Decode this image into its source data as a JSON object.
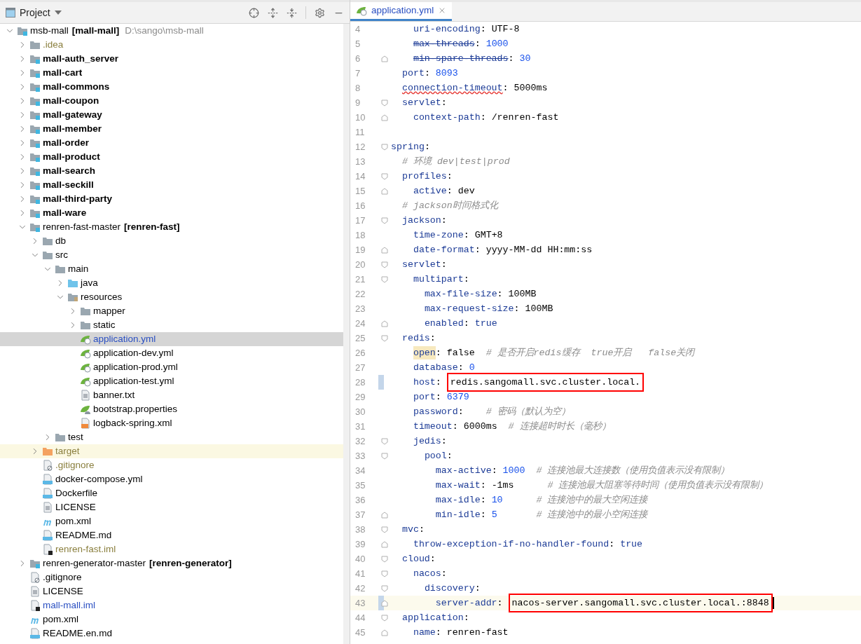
{
  "project_panel": {
    "title": "Project",
    "tree": [
      {
        "name": "msb-mall",
        "tag": "[mall-mall]",
        "path": "D:\\sango\\msb-mall",
        "kind": "module",
        "bold": false,
        "color": "#000000",
        "selected": false,
        "expanded": true,
        "children": [
          {
            "name": ".idea",
            "kind": "folder",
            "bold": false,
            "color": "#8a7f3e",
            "selected": false,
            "expanded": false
          },
          {
            "name": "mall-auth_server",
            "kind": "module",
            "bold": true,
            "color": "#000000",
            "selected": false,
            "expanded": false
          },
          {
            "name": "mall-cart",
            "kind": "module",
            "bold": true,
            "color": "#000000",
            "selected": false,
            "expanded": false
          },
          {
            "name": "mall-commons",
            "kind": "module",
            "bold": true,
            "color": "#000000",
            "selected": false,
            "expanded": false
          },
          {
            "name": "mall-coupon",
            "kind": "module",
            "bold": true,
            "color": "#000000",
            "selected": false,
            "expanded": false
          },
          {
            "name": "mall-gateway",
            "kind": "module",
            "bold": true,
            "color": "#000000",
            "selected": false,
            "expanded": false
          },
          {
            "name": "mall-member",
            "kind": "module",
            "bold": true,
            "color": "#000000",
            "selected": false,
            "expanded": false
          },
          {
            "name": "mall-order",
            "kind": "module",
            "bold": true,
            "color": "#000000",
            "selected": false,
            "expanded": false
          },
          {
            "name": "mall-product",
            "kind": "module",
            "bold": true,
            "color": "#000000",
            "selected": false,
            "expanded": false
          },
          {
            "name": "mall-search",
            "kind": "module",
            "bold": true,
            "color": "#000000",
            "selected": false,
            "expanded": false
          },
          {
            "name": "mall-seckill",
            "kind": "module",
            "bold": true,
            "color": "#000000",
            "selected": false,
            "expanded": false
          },
          {
            "name": "mall-third-party",
            "kind": "module",
            "bold": true,
            "color": "#000000",
            "selected": false,
            "expanded": false
          },
          {
            "name": "mall-ware",
            "kind": "module",
            "bold": true,
            "color": "#000000",
            "selected": false,
            "expanded": false
          },
          {
            "name": "renren-fast-master",
            "tag": "[renren-fast]",
            "kind": "module",
            "bold": false,
            "color": "#000000",
            "selected": false,
            "expanded": true,
            "children": [
              {
                "name": "db",
                "kind": "folder",
                "bold": false,
                "color": "#000000",
                "selected": false,
                "expanded": false
              },
              {
                "name": "src",
                "kind": "folder",
                "bold": false,
                "color": "#000000",
                "selected": false,
                "expanded": true,
                "children": [
                  {
                    "name": "main",
                    "kind": "folder",
                    "bold": false,
                    "color": "#000000",
                    "selected": false,
                    "expanded": true,
                    "children": [
                      {
                        "name": "java",
                        "kind": "source",
                        "bold": false,
                        "color": "#000000",
                        "selected": false,
                        "expanded": false
                      },
                      {
                        "name": "resources",
                        "kind": "resources",
                        "bold": false,
                        "color": "#000000",
                        "selected": false,
                        "expanded": true,
                        "children": [
                          {
                            "name": "mapper",
                            "kind": "folder",
                            "bold": false,
                            "color": "#000000",
                            "selected": false,
                            "expanded": false
                          },
                          {
                            "name": "static",
                            "kind": "folder",
                            "bold": false,
                            "color": "#000000",
                            "selected": false,
                            "expanded": false
                          },
                          {
                            "name": "application.yml",
                            "kind": "spring",
                            "bold": false,
                            "color": "#2a4fc2",
                            "selected": true
                          },
                          {
                            "name": "application-dev.yml",
                            "kind": "spring",
                            "bold": false,
                            "color": "#000000",
                            "selected": false
                          },
                          {
                            "name": "application-prod.yml",
                            "kind": "spring",
                            "bold": false,
                            "color": "#000000",
                            "selected": false
                          },
                          {
                            "name": "application-test.yml",
                            "kind": "spring",
                            "bold": false,
                            "color": "#000000",
                            "selected": false
                          },
                          {
                            "name": "banner.txt",
                            "kind": "text",
                            "bold": false,
                            "color": "#000000",
                            "selected": false
                          },
                          {
                            "name": "bootstrap.properties",
                            "kind": "properties",
                            "bold": false,
                            "color": "#000000",
                            "selected": false
                          },
                          {
                            "name": "logback-spring.xml",
                            "kind": "xml",
                            "bold": false,
                            "color": "#000000",
                            "selected": false
                          }
                        ]
                      }
                    ]
                  },
                  {
                    "name": "test",
                    "kind": "folder",
                    "bold": false,
                    "color": "#000000",
                    "selected": false,
                    "expanded": false
                  }
                ]
              },
              {
                "name": "target",
                "kind": "excluded",
                "bold": false,
                "color": "#8a7f3e",
                "selected": false,
                "expanded": false
              },
              {
                "name": ".gitignore",
                "kind": "ignore",
                "bold": false,
                "color": "#8a7f3e",
                "selected": false
              },
              {
                "name": "docker-compose.yml",
                "kind": "compose",
                "bold": false,
                "color": "#000000",
                "selected": false
              },
              {
                "name": "Dockerfile",
                "kind": "docker",
                "bold": false,
                "color": "#000000",
                "selected": false
              },
              {
                "name": "LICENSE",
                "kind": "text",
                "bold": false,
                "color": "#000000",
                "selected": false
              },
              {
                "name": "pom.xml",
                "kind": "maven",
                "bold": false,
                "color": "#000000",
                "selected": false
              },
              {
                "name": "README.md",
                "kind": "markdown",
                "bold": false,
                "color": "#000000",
                "selected": false
              },
              {
                "name": "renren-fast.iml",
                "kind": "iml",
                "bold": false,
                "color": "#8a7f3e",
                "selected": false
              }
            ]
          },
          {
            "name": "renren-generator-master",
            "tag": "[renren-generator]",
            "kind": "module",
            "bold": false,
            "color": "#000000",
            "selected": false,
            "expanded": false
          },
          {
            "name": ".gitignore",
            "kind": "ignore",
            "bold": false,
            "color": "#000000",
            "selected": false
          },
          {
            "name": "LICENSE",
            "kind": "text",
            "bold": false,
            "color": "#000000",
            "selected": false
          },
          {
            "name": "mall-mall.iml",
            "kind": "iml",
            "bold": false,
            "color": "#2a4fc2",
            "selected": false
          },
          {
            "name": "pom.xml",
            "kind": "maven",
            "bold": false,
            "color": "#000000",
            "selected": false
          },
          {
            "name": "README.en.md",
            "kind": "markdown",
            "bold": false,
            "color": "#000000",
            "selected": false
          }
        ]
      }
    ]
  },
  "editor": {
    "tabs": [
      {
        "label": "application.yml",
        "selected": true
      }
    ],
    "lines": [
      {
        "children": [
          {
            "children": [
              {
                "n": "4",
                "segs": [
                  {
                    "kind": "key",
                    "text": "uri-encoding"
                  },
                  {
                    "kind": "punct",
                    "text": ": "
                  },
                  {
                    "kind": "string",
                    "text": "UTF-8"
                  }
                ]
              },
              {
                "n": "5",
                "segs": [
                  {
                    "kind": "key",
                    "text": "max-threads",
                    "deprecated": true
                  },
                  {
                    "kind": "punct",
                    "text": ": "
                  },
                  {
                    "kind": "number",
                    "text": "1000"
                  }
                ]
              },
              {
                "n": "6",
                "segs": [
                  {
                    "kind": "key",
                    "text": "min-spare-threads",
                    "deprecated": true
                  },
                  {
                    "kind": "punct",
                    "text": ": "
                  },
                  {
                    "kind": "number",
                    "text": "30"
                  }
                ]
              }
            ]
          },
          {
            "n": "7",
            "segs": [
              {
                "kind": "key",
                "text": "port"
              },
              {
                "kind": "punct",
                "text": ": "
              },
              {
                "kind": "number",
                "text": "8093"
              }
            ]
          },
          {
            "n": "8",
            "segs": [
              {
                "kind": "key",
                "text": "connection-timeout",
                "warning": true
              },
              {
                "kind": "punct",
                "text": ": "
              },
              {
                "kind": "string",
                "text": "5000ms"
              }
            ]
          },
          {
            "n": "9",
            "segs": [
              {
                "kind": "key",
                "text": "servlet"
              },
              {
                "kind": "punct",
                "text": ":"
              }
            ],
            "children": [
              {
                "n": "10",
                "segs": [
                  {
                    "kind": "key",
                    "text": "context-path"
                  },
                  {
                    "kind": "punct",
                    "text": ": "
                  },
                  {
                    "kind": "string",
                    "text": "/renren-fast"
                  }
                ]
              }
            ]
          }
        ]
      },
      {
        "n": "11"
      },
      {
        "n": "12",
        "segs": [
          {
            "kind": "key",
            "text": "spring"
          },
          {
            "kind": "punct",
            "text": ":"
          }
        ],
        "children": [
          {
            "n": "13",
            "segs": [
              {
                "kind": "comment",
                "text": "# 环境 dev|test|prod"
              }
            ]
          },
          {
            "n": "14",
            "segs": [
              {
                "kind": "key",
                "text": "profiles"
              },
              {
                "kind": "punct",
                "text": ":"
              }
            ],
            "children": [
              {
                "n": "15",
                "segs": [
                  {
                    "kind": "key",
                    "text": "active"
                  },
                  {
                    "kind": "punct",
                    "text": ": "
                  },
                  {
                    "kind": "string",
                    "text": "dev"
                  }
                ]
              }
            ]
          },
          {
            "n": "16",
            "segs": [
              {
                "kind": "comment",
                "text": "# jackson时间格式化"
              }
            ]
          },
          {
            "n": "17",
            "segs": [
              {
                "kind": "key",
                "text": "jackson"
              },
              {
                "kind": "punct",
                "text": ":"
              }
            ],
            "children": [
              {
                "n": "18",
                "segs": [
                  {
                    "kind": "key",
                    "text": "time-zone"
                  },
                  {
                    "kind": "punct",
                    "text": ": "
                  },
                  {
                    "kind": "string",
                    "text": "GMT+8"
                  }
                ]
              },
              {
                "n": "19",
                "segs": [
                  {
                    "kind": "key",
                    "text": "date-format"
                  },
                  {
                    "kind": "punct",
                    "text": ": "
                  },
                  {
                    "kind": "string",
                    "text": "yyyy-MM-dd HH:mm:ss"
                  }
                ]
              }
            ]
          },
          {
            "n": "20",
            "segs": [
              {
                "kind": "key",
                "text": "servlet"
              },
              {
                "kind": "punct",
                "text": ":"
              }
            ],
            "children": [
              {
                "n": "21",
                "segs": [
                  {
                    "kind": "key",
                    "text": "multipart"
                  },
                  {
                    "kind": "punct",
                    "text": ":"
                  }
                ],
                "children": [
                  {
                    "n": "22",
                    "segs": [
                      {
                        "kind": "key",
                        "text": "max-file-size"
                      },
                      {
                        "kind": "punct",
                        "text": ": "
                      },
                      {
                        "kind": "string",
                        "text": "100MB"
                      }
                    ]
                  },
                  {
                    "n": "23",
                    "segs": [
                      {
                        "kind": "key",
                        "text": "max-request-size"
                      },
                      {
                        "kind": "punct",
                        "text": ": "
                      },
                      {
                        "kind": "string",
                        "text": "100MB"
                      }
                    ]
                  },
                  {
                    "n": "24",
                    "segs": [
                      {
                        "kind": "key",
                        "text": "enabled"
                      },
                      {
                        "kind": "punct",
                        "text": ": "
                      },
                      {
                        "kind": "keyword",
                        "text": "true"
                      }
                    ]
                  }
                ]
              }
            ]
          },
          {
            "n": "25",
            "segs": [
              {
                "kind": "key",
                "text": "redis"
              },
              {
                "kind": "punct",
                "text": ":"
              }
            ],
            "children": [
              {
                "n": "26",
                "segs": [
                  {
                    "kind": "key",
                    "text": "open",
                    "highlighted": true
                  },
                  {
                    "kind": "punct",
                    "text": ": "
                  },
                  {
                    "kind": "string",
                    "text": "false"
                  },
                  {
                    "kind": "comment",
                    "text": "  # 是否开启redis缓存  true开启   false关闭"
                  }
                ]
              },
              {
                "n": "27",
                "segs": [
                  {
                    "kind": "key",
                    "text": "database"
                  },
                  {
                    "kind": "punct",
                    "text": ": "
                  },
                  {
                    "kind": "number",
                    "text": "0"
                  }
                ]
              },
              {
                "n": "28",
                "changed": true,
                "segs": [
                  {
                    "kind": "key",
                    "text": "host"
                  },
                  {
                    "kind": "punct",
                    "text": ": "
                  },
                  {
                    "kind": "string",
                    "text": "redis.sangomall.svc.cluster.local.",
                    "boxed": true
                  }
                ]
              },
              {
                "n": "29",
                "segs": [
                  {
                    "kind": "key",
                    "text": "port"
                  },
                  {
                    "kind": "punct",
                    "text": ": "
                  },
                  {
                    "kind": "number",
                    "text": "6379"
                  }
                ]
              },
              {
                "n": "30",
                "segs": [
                  {
                    "kind": "key",
                    "text": "password"
                  },
                  {
                    "kind": "punct",
                    "text": ":"
                  },
                  {
                    "kind": "comment",
                    "text": "    # 密码（默认为空）"
                  }
                ]
              },
              {
                "n": "31",
                "segs": [
                  {
                    "kind": "key",
                    "text": "timeout"
                  },
                  {
                    "kind": "punct",
                    "text": ": "
                  },
                  {
                    "kind": "string",
                    "text": "6000ms"
                  },
                  {
                    "kind": "comment",
                    "text": "  # 连接超时时长（毫秒）"
                  }
                ]
              },
              {
                "n": "32",
                "segs": [
                  {
                    "kind": "key",
                    "text": "jedis"
                  },
                  {
                    "kind": "punct",
                    "text": ":"
                  }
                ],
                "children": [
                  {
                    "n": "33",
                    "segs": [
                      {
                        "kind": "key",
                        "text": "pool"
                      },
                      {
                        "kind": "punct",
                        "text": ":"
                      }
                    ],
                    "children": [
                      {
                        "n": "34",
                        "segs": [
                          {
                            "kind": "key",
                            "text": "max-active"
                          },
                          {
                            "kind": "punct",
                            "text": ": "
                          },
                          {
                            "kind": "number",
                            "text": "1000"
                          },
                          {
                            "kind": "comment",
                            "text": "  # 连接池最大连接数（使用负值表示没有限制）"
                          }
                        ]
                      },
                      {
                        "n": "35",
                        "segs": [
                          {
                            "kind": "key",
                            "text": "max-wait"
                          },
                          {
                            "kind": "punct",
                            "text": ": "
                          },
                          {
                            "kind": "string",
                            "text": "-1ms"
                          },
                          {
                            "kind": "comment",
                            "text": "      # 连接池最大阻塞等待时间（使用负值表示没有限制）"
                          }
                        ]
                      },
                      {
                        "n": "36",
                        "segs": [
                          {
                            "kind": "key",
                            "text": "max-idle"
                          },
                          {
                            "kind": "punct",
                            "text": ": "
                          },
                          {
                            "kind": "number",
                            "text": "10"
                          },
                          {
                            "kind": "comment",
                            "text": "      # 连接池中的最大空闲连接"
                          }
                        ]
                      },
                      {
                        "n": "37",
                        "segs": [
                          {
                            "kind": "key",
                            "text": "min-idle"
                          },
                          {
                            "kind": "punct",
                            "text": ": "
                          },
                          {
                            "kind": "number",
                            "text": "5"
                          },
                          {
                            "kind": "comment",
                            "text": "       # 连接池中的最小空闲连接"
                          }
                        ]
                      }
                    ]
                  }
                ]
              }
            ]
          },
          {
            "n": "38",
            "segs": [
              {
                "kind": "key",
                "text": "mvc"
              },
              {
                "kind": "punct",
                "text": ":"
              }
            ],
            "children": [
              {
                "n": "39",
                "segs": [
                  {
                    "kind": "key",
                    "text": "throw-exception-if-no-handler-found"
                  },
                  {
                    "kind": "punct",
                    "text": ": "
                  },
                  {
                    "kind": "keyword",
                    "text": "true"
                  }
                ]
              }
            ]
          },
          {
            "n": "40",
            "segs": [
              {
                "kind": "key",
                "text": "cloud"
              },
              {
                "kind": "punct",
                "text": ":"
              }
            ],
            "children": [
              {
                "n": "41",
                "segs": [
                  {
                    "kind": "key",
                    "text": "nacos"
                  },
                  {
                    "kind": "punct",
                    "text": ":"
                  }
                ],
                "children": [
                  {
                    "n": "42",
                    "segs": [
                      {
                        "kind": "key",
                        "text": "discovery"
                      },
                      {
                        "kind": "punct",
                        "text": ":"
                      }
                    ],
                    "children": [
                      {
                        "n": "43",
                        "changed": true,
                        "current": true,
                        "caret": true,
                        "segs": [
                          {
                            "kind": "key",
                            "text": "server-addr"
                          },
                          {
                            "kind": "punct",
                            "text": ": "
                          },
                          {
                            "kind": "string",
                            "text": "nacos-server.sangomall.svc.cluster.local.:8848",
                            "boxed": true
                          }
                        ]
                      }
                    ]
                  }
                ]
              }
            ]
          },
          {
            "n": "44",
            "segs": [
              {
                "kind": "key",
                "text": "application"
              },
              {
                "kind": "punct",
                "text": ":"
              }
            ],
            "children": [
              {
                "n": "45",
                "segs": [
                  {
                    "kind": "key",
                    "text": "name"
                  },
                  {
                    "kind": "punct",
                    "text": ": "
                  },
                  {
                    "kind": "string",
                    "text": "renren-fast"
                  }
                ]
              }
            ]
          }
        ]
      }
    ]
  }
}
